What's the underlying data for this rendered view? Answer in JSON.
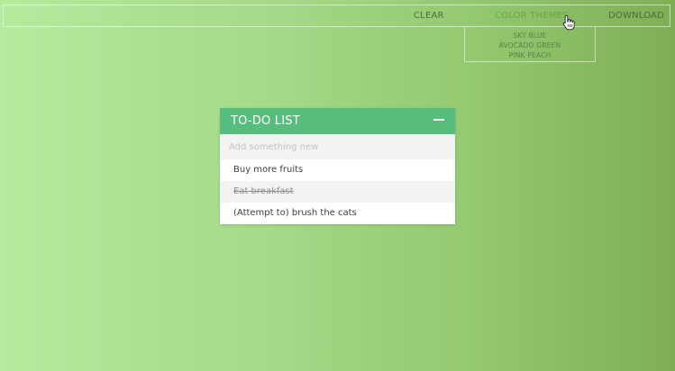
{
  "nav": {
    "clear": "CLEAR",
    "color_themes": "COLOR THEMES",
    "download": "DOWNLOAD"
  },
  "themes_menu": {
    "options": [
      "SKY BLUE",
      "AVOCADO GREEN",
      "PINK PEACH"
    ]
  },
  "todo": {
    "title": "TO-DO LIST",
    "collapse_icon": "minus-icon",
    "input_placeholder": "Add something new",
    "input_value": "",
    "items": [
      {
        "text": "Buy more fruits",
        "done": false
      },
      {
        "text": "Eat breakfast",
        "done": true
      },
      {
        "text": "(Attempt to) brush the cats",
        "done": false
      }
    ]
  },
  "colors": {
    "header": "#56bd7d",
    "active_nav": "#6aa347",
    "gradient_start": "#b4eb9c",
    "gradient_end": "#7fae55"
  }
}
